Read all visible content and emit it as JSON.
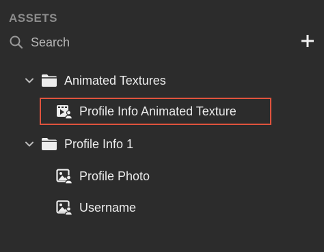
{
  "header": {
    "title": "ASSETS"
  },
  "search": {
    "label": "Search"
  },
  "toolbar": {
    "add_icon": "plus-icon"
  },
  "tree": {
    "folder1": {
      "label": "Animated Textures",
      "expanded": true,
      "icon": "folder-icon"
    },
    "folder1_item1": {
      "label": "Profile Info Animated Texture",
      "icon": "animated-texture-icon",
      "highlighted": true
    },
    "folder2": {
      "label": "Profile Info 1",
      "expanded": true,
      "icon": "folder-icon"
    },
    "folder2_item1": {
      "label": "Profile Photo",
      "icon": "image-user-icon"
    },
    "folder2_item2": {
      "label": "Username",
      "icon": "image-user-icon"
    }
  },
  "colors": {
    "background": "#2c2c2c",
    "highlight_border": "#e0533d",
    "text": "#ececec",
    "muted": "#8d8d8d"
  }
}
